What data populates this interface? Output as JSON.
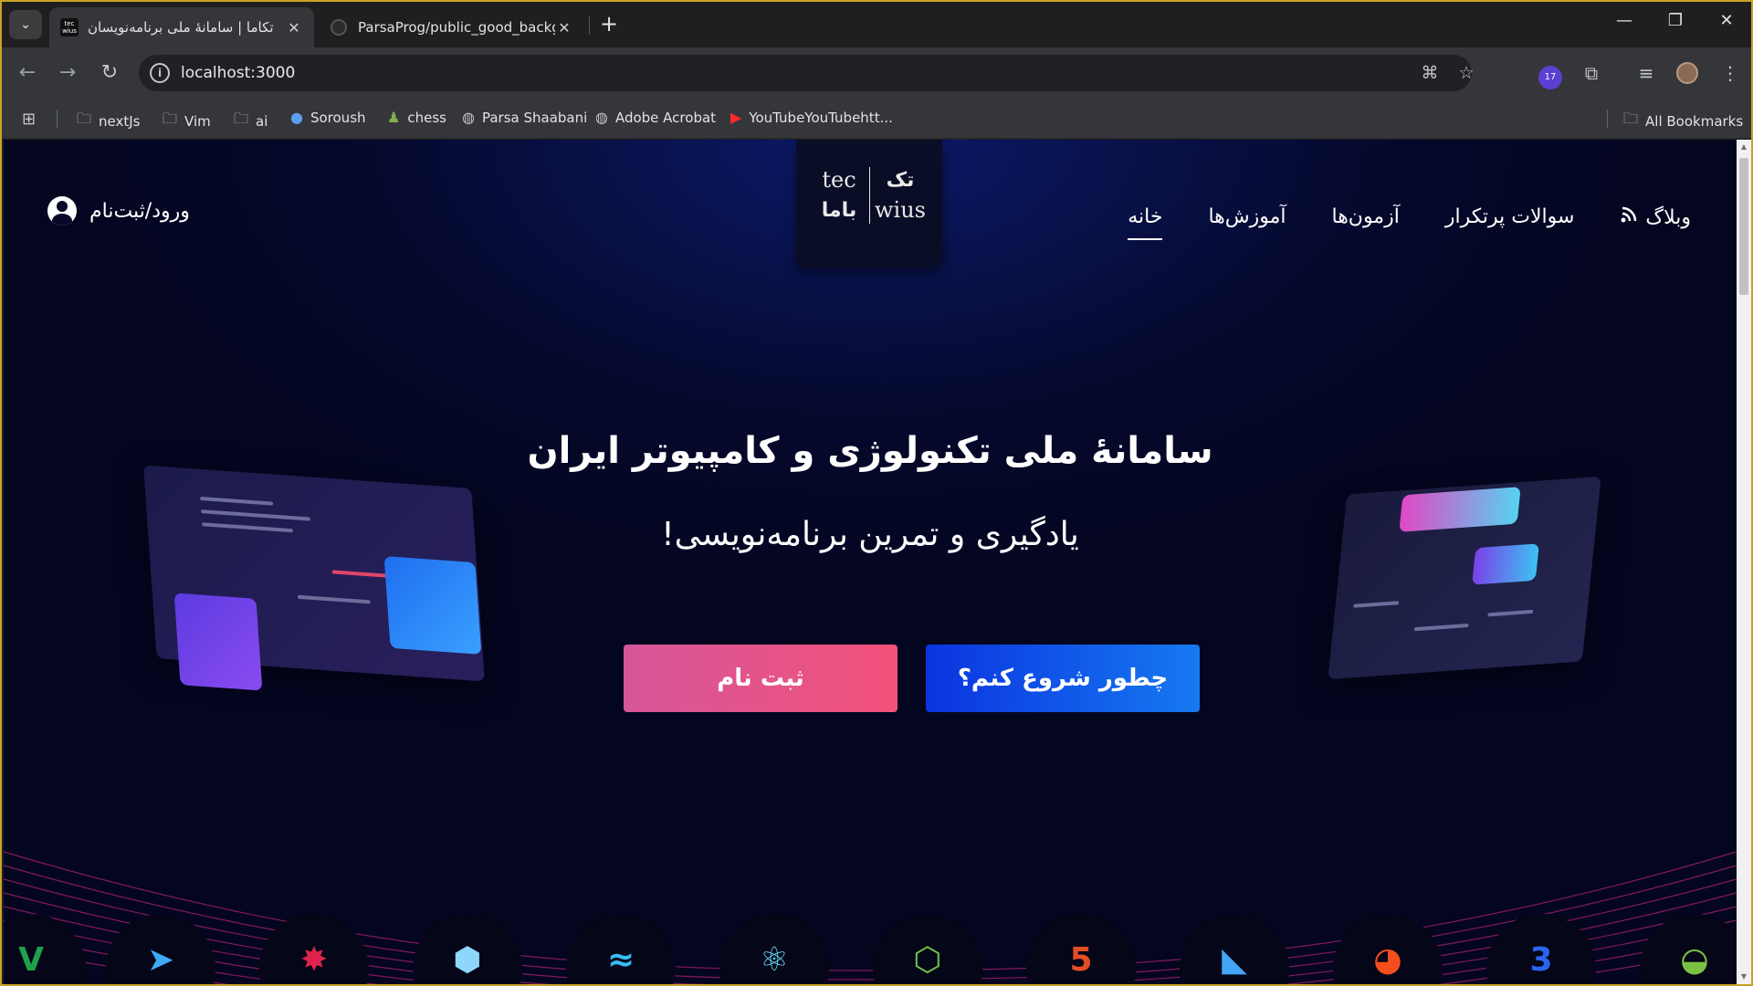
{
  "browser": {
    "tabs": [
      {
        "title": "تکاما | سامانهٔ ملی برنامه‌نویسان",
        "favicon": "tec\nwius",
        "active": true
      },
      {
        "title": "ParsaProg/public_good_backgr",
        "active": false
      }
    ],
    "url": "localhost:3000",
    "extension_badge": "17",
    "bookmarks": [
      {
        "label": "nextJs",
        "icon": "folder-icon"
      },
      {
        "label": "Vim",
        "icon": "folder-icon"
      },
      {
        "label": "ai",
        "icon": "folder-icon"
      },
      {
        "label": "Soroush",
        "icon": "soroush-icon"
      },
      {
        "label": "chess",
        "icon": "chess-icon"
      },
      {
        "label": "Parsa Shaabani",
        "icon": "globe-icon"
      },
      {
        "label": "Adobe Acrobat",
        "icon": "globe-icon"
      },
      {
        "label": "YouTubeYouTubehtt...",
        "icon": "youtube-icon"
      }
    ],
    "all_bookmarks": "All Bookmarks"
  },
  "site": {
    "nav": {
      "home": "خانه",
      "tutorials": "آموزش‌ها",
      "exams": "آزمون‌ها",
      "faq": "سوالات پرتکرار",
      "blog": "وبلاگ"
    },
    "logo": {
      "left_top": "tec",
      "left_bottom": "باما",
      "right_top": "تک",
      "right_bottom": "wius"
    },
    "login": "ورود/ثبت‌نام",
    "hero": {
      "title": "سامانهٔ ملی تکنولوژی و کامپیوتر ایران",
      "subtitle": "یادگیری و تمرین برنامه‌نویسی!",
      "register_button": "ثبت نام",
      "start_button": "چطور شروع کنم؟"
    },
    "tech_icons": [
      "vim-icon",
      "swift-icon",
      "nestjs-icon",
      "webpack-icon",
      "tailwind-icon",
      "react-icon",
      "nodejs-icon",
      "html5-icon",
      "flutter-icon",
      "figma-icon",
      "css3-icon",
      "android-icon"
    ]
  },
  "colors": {
    "accent_blue": "#0b34e0",
    "accent_pink": "#f2527a",
    "page_bg": "#05082a"
  }
}
